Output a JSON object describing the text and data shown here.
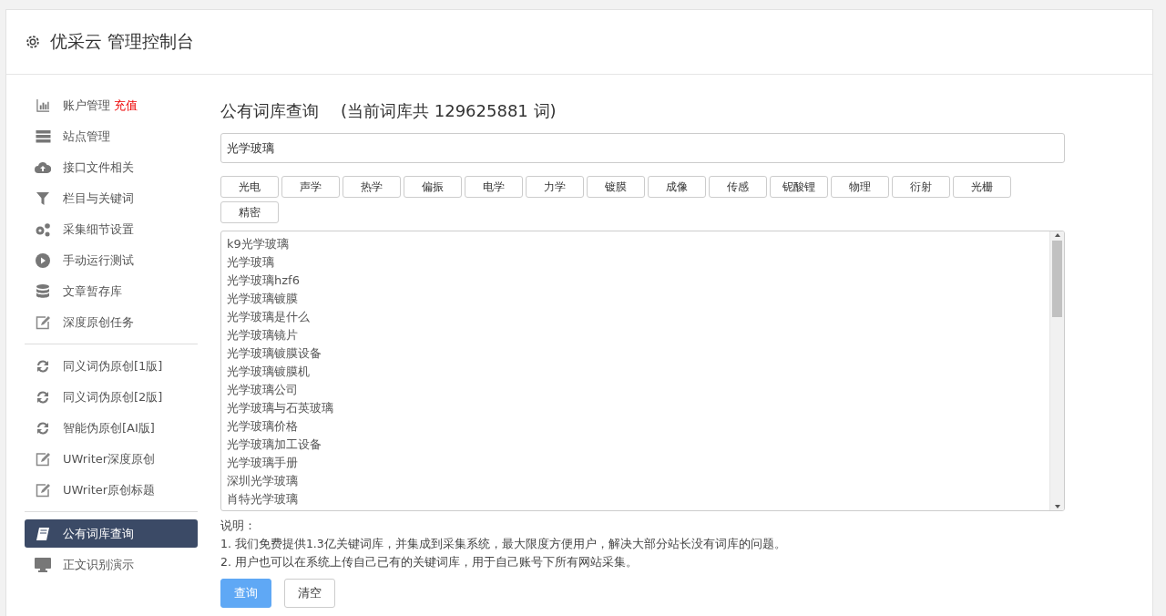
{
  "header": {
    "title": "优采云 管理控制台"
  },
  "sidebar": {
    "groups": [
      {
        "items": [
          {
            "label": "账户管理",
            "badge": "充值",
            "kind": "chart",
            "selected": false
          },
          {
            "label": "站点管理",
            "kind": "server",
            "selected": false
          },
          {
            "label": "接口文件相关",
            "kind": "cloud",
            "selected": false
          },
          {
            "label": "栏目与关键词",
            "kind": "filter",
            "selected": false
          },
          {
            "label": "采集细节设置",
            "kind": "gears",
            "selected": false
          },
          {
            "label": "手动运行测试",
            "kind": "play",
            "selected": false
          },
          {
            "label": "文章暂存库",
            "kind": "database",
            "selected": false
          },
          {
            "label": "深度原创任务",
            "kind": "edit",
            "selected": false
          }
        ]
      },
      {
        "items": [
          {
            "label": "同义词伪原创[1版]",
            "kind": "refresh",
            "selected": false
          },
          {
            "label": "同义词伪原创[2版]",
            "kind": "refresh",
            "selected": false
          },
          {
            "label": "智能伪原创[AI版]",
            "kind": "refresh",
            "selected": false
          },
          {
            "label": "UWriter深度原创",
            "kind": "edit",
            "selected": false
          },
          {
            "label": "UWriter原创标题",
            "kind": "edit",
            "selected": false
          }
        ]
      },
      {
        "items": [
          {
            "label": "公有词库查询",
            "kind": "book",
            "selected": true
          },
          {
            "label": "正文识别演示",
            "kind": "monitor",
            "selected": false
          }
        ]
      }
    ]
  },
  "main": {
    "title": "公有词库查询",
    "count_text": "(当前词库共 129625881 词)",
    "search": {
      "value": "光学玻璃"
    },
    "tags": [
      "光电",
      "声学",
      "热学",
      "偏振",
      "电学",
      "力学",
      "镀膜",
      "成像",
      "传感",
      "铌酸锂",
      "物理",
      "衍射",
      "光栅",
      "精密"
    ],
    "results": [
      "k9光学玻璃",
      "光学玻璃",
      "光学玻璃hzf6",
      "光学玻璃镀膜",
      "光学玻璃是什么",
      "光学玻璃镜片",
      "光学玻璃镀膜设备",
      "光学玻璃镀膜机",
      "光学玻璃公司",
      "光学玻璃与石英玻璃",
      "光学玻璃价格",
      "光学玻璃加工设备",
      "光学玻璃手册",
      "深圳光学玻璃",
      "肖特光学玻璃"
    ],
    "notes_title": "说明：",
    "notes": [
      "1. 我们免费提供1.3亿关键词库，并集成到采集系统，最大限度方便用户，解决大部分站长没有词库的问题。",
      "2. 用户也可以在系统上传自己已有的关键词库，用于自己账号下所有网站采集。"
    ],
    "buttons": [
      {
        "label": "查询",
        "kind": "primary"
      },
      {
        "label": "清空",
        "kind": "default"
      }
    ]
  }
}
